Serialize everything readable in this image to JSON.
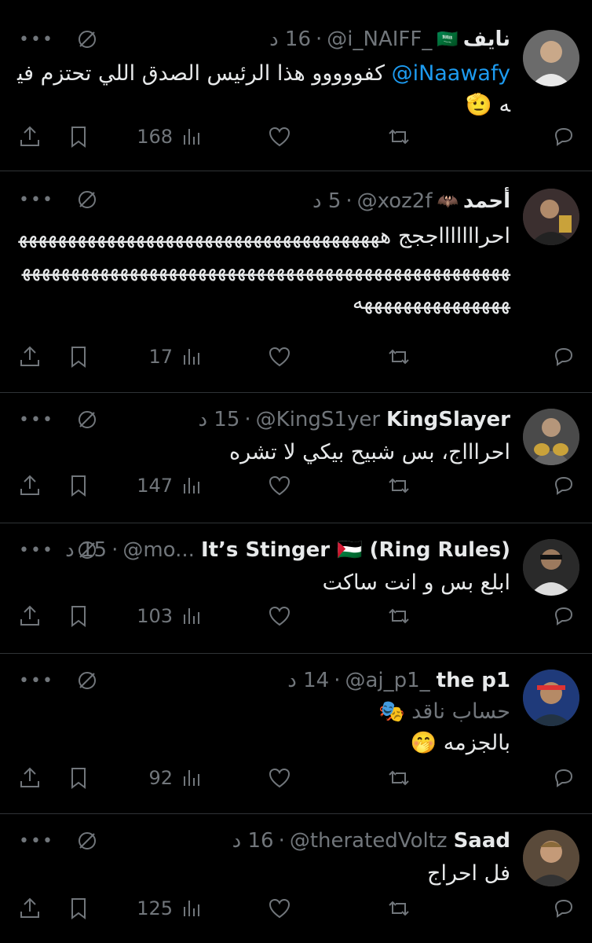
{
  "tweets": [
    {
      "name": "نايف",
      "flag": "🇸🇦",
      "handle": "@i_NAIFF_",
      "time": "16 د",
      "mention": "@iNaawafy",
      "text": "كفووووو هذا الرئيس الصدق اللي تحتزم فيه 🫡",
      "views": "168",
      "avatar_color": "#6b6b6b"
    },
    {
      "name": "أحمد",
      "flag": "🦇",
      "handle": "@xoz2f",
      "time": "5 د",
      "text": "احراااااااججج هههههههههههههههههههههههههههههههههههههههههههههههههههههههههههههههههههههههههههههههههههههههههههههههههههههههه",
      "views": "17",
      "avatar_color": "#3b2f2f"
    },
    {
      "name": "KingSlayer",
      "handle": "@KingS1yer",
      "time": "15 د",
      "text": "احراااج، بس شبيح بيكي لا تشره",
      "views": "147",
      "avatar_color": "#4a4a4a"
    },
    {
      "name": "It’s Stinger 🇵🇸 (Ring Rules)",
      "handle": "@mo...",
      "time": "15 د",
      "text": "ابلع بس و انت ساكت",
      "views": "103",
      "avatar_color": "#2a2a2a"
    },
    {
      "name": "the p1",
      "handle": "@aj_p1_",
      "time": "14 د",
      "subtitle": "حساب ناقد 🎭",
      "text": "بالجزمه 🤭",
      "views": "92",
      "avatar_color": "#1f3a7a"
    },
    {
      "name": "Saad",
      "handle": "@theratedVoltz",
      "time": "16 د",
      "text": "فل احراج",
      "views": "125",
      "avatar_color": "#5a4a3a"
    }
  ],
  "icons": {
    "more": "more-icon",
    "mute": "mute-icon",
    "reply": "reply-icon",
    "retweet": "retweet-icon",
    "like": "like-icon",
    "views": "views-icon",
    "bookmark": "bookmark-icon",
    "share": "share-icon"
  },
  "colors": {
    "background": "#000000",
    "mention": "#1d9bf0",
    "muted": "#71767b",
    "text": "#e7e9ea"
  }
}
